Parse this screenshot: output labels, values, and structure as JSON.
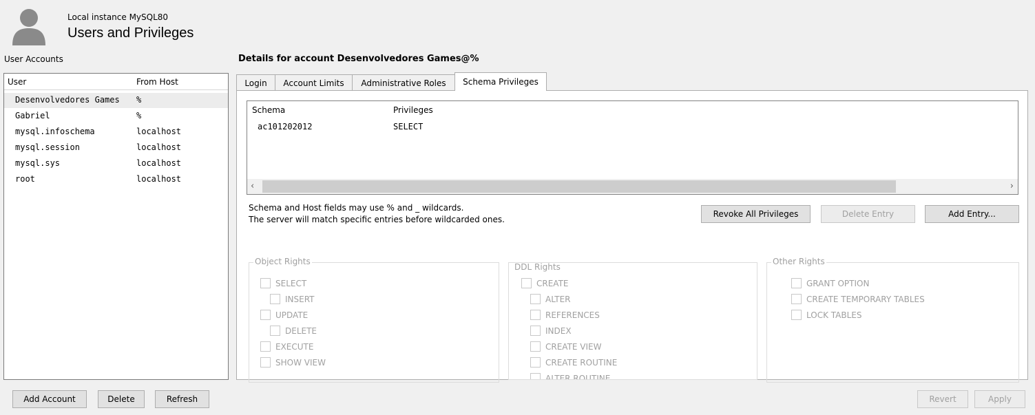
{
  "header": {
    "instance": "Local instance MySQL80",
    "title": "Users and Privileges",
    "avatar_icon": "user-silhouette-icon"
  },
  "left_panel": {
    "label": "User Accounts",
    "columns": [
      "User",
      "From Host"
    ],
    "users": [
      {
        "user": "Desenvolvedores Games",
        "host": "%"
      },
      {
        "user": "Gabriel",
        "host": "%"
      },
      {
        "user": "mysql.infoschema",
        "host": "localhost"
      },
      {
        "user": "mysql.session",
        "host": "localhost"
      },
      {
        "user": "mysql.sys",
        "host": "localhost"
      },
      {
        "user": "root",
        "host": "localhost"
      }
    ],
    "buttons": {
      "add": "Add Account",
      "delete": "Delete",
      "refresh": "Refresh"
    }
  },
  "details": {
    "title": "Details for account Desenvolvedores Games@%",
    "tabs": [
      "Login",
      "Account Limits",
      "Administrative Roles",
      "Schema Privileges"
    ],
    "active_tab": "Schema Privileges",
    "schema_columns": [
      "Schema",
      "Privileges"
    ],
    "schema_rows": [
      {
        "schema": "ac101202012",
        "privileges": "SELECT"
      }
    ],
    "wildcard_line1": "Schema and Host fields may use % and _ wildcards.",
    "wildcard_line2": "The server will match specific entries before wildcarded ones.",
    "buttons": {
      "revoke": "Revoke All Privileges",
      "delete_entry": "Delete Entry",
      "add_entry": "Add Entry..."
    },
    "object_rights": {
      "title": "Object Rights",
      "items": [
        "SELECT",
        "INSERT",
        "UPDATE",
        "DELETE",
        "EXECUTE",
        "SHOW VIEW"
      ]
    },
    "ddl_rights": {
      "title": "DDL Rights",
      "items": [
        "CREATE",
        "ALTER",
        "REFERENCES",
        "INDEX",
        "CREATE VIEW",
        "CREATE ROUTINE",
        "ALTER ROUTINE"
      ]
    },
    "other_rights": {
      "title": "Other Rights",
      "items": [
        "GRANT OPTION",
        "CREATE TEMPORARY TABLES",
        "LOCK TABLES"
      ]
    }
  },
  "footer": {
    "revert": "Revert",
    "apply": "Apply"
  }
}
